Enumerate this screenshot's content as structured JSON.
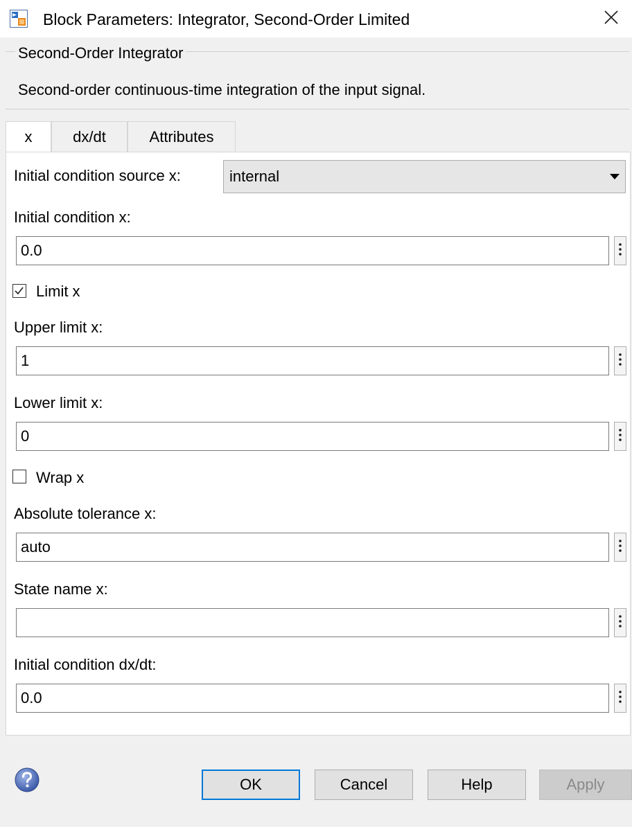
{
  "window": {
    "title": "Block Parameters: Integrator, Second-Order Limited",
    "close_icon": "close-icon",
    "app_icon": "simulink-block-icon"
  },
  "description": {
    "group_title": "Second-Order Integrator",
    "text": "Second-order continuous-time integration of the input signal."
  },
  "tabs": [
    {
      "label": "x",
      "active": true
    },
    {
      "label": "dx/dt",
      "active": false
    },
    {
      "label": "Attributes",
      "active": false
    }
  ],
  "params": {
    "ic_source_label": "Initial condition source x:",
    "ic_source_value": "internal",
    "ic_x_label": "Initial condition x:",
    "ic_x_value": "0.0",
    "limit_x_label": "Limit x",
    "limit_x_checked": true,
    "upper_label": "Upper limit x:",
    "upper_value": "1",
    "lower_label": "Lower limit x:",
    "lower_value": "0",
    "wrap_x_label": "Wrap x",
    "wrap_x_checked": false,
    "abs_tol_label": "Absolute tolerance x:",
    "abs_tol_value": "auto",
    "state_name_label": "State name x:",
    "state_name_value": "",
    "ic_dxdt_label": "Initial condition dx/dt:",
    "ic_dxdt_value": "0.0"
  },
  "buttons": {
    "ok": "OK",
    "cancel": "Cancel",
    "help": "Help",
    "apply": "Apply"
  },
  "colors": {
    "accent": "#0078d7",
    "background": "#f0f0f0"
  }
}
